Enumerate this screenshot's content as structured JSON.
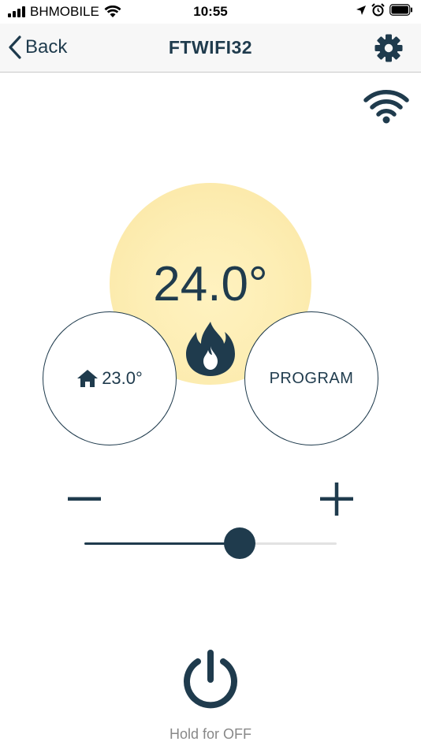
{
  "status_bar": {
    "carrier": "BHMOBILE",
    "time": "10:55"
  },
  "nav": {
    "back_label": "Back",
    "title": "FTWIFI32",
    "icons": [
      "chevron-left-icon",
      "gear-icon"
    ]
  },
  "connection": {
    "icon": "wifi-icon"
  },
  "thermostat": {
    "setpoint": "24.0°",
    "heating_icon": "flame-icon",
    "room_icon": "home-icon",
    "room_temperature": "23.0°",
    "program_label": "PROGRAM",
    "slider_fraction": 0.616
  },
  "controls": {
    "minus_icon": "minus-icon",
    "plus_icon": "plus-icon"
  },
  "power": {
    "icon": "power-icon",
    "hint": "Hold for OFF"
  },
  "colors": {
    "primary": "#1f3b4d",
    "sun": "#fdeeb5",
    "hint_text": "#888888"
  }
}
